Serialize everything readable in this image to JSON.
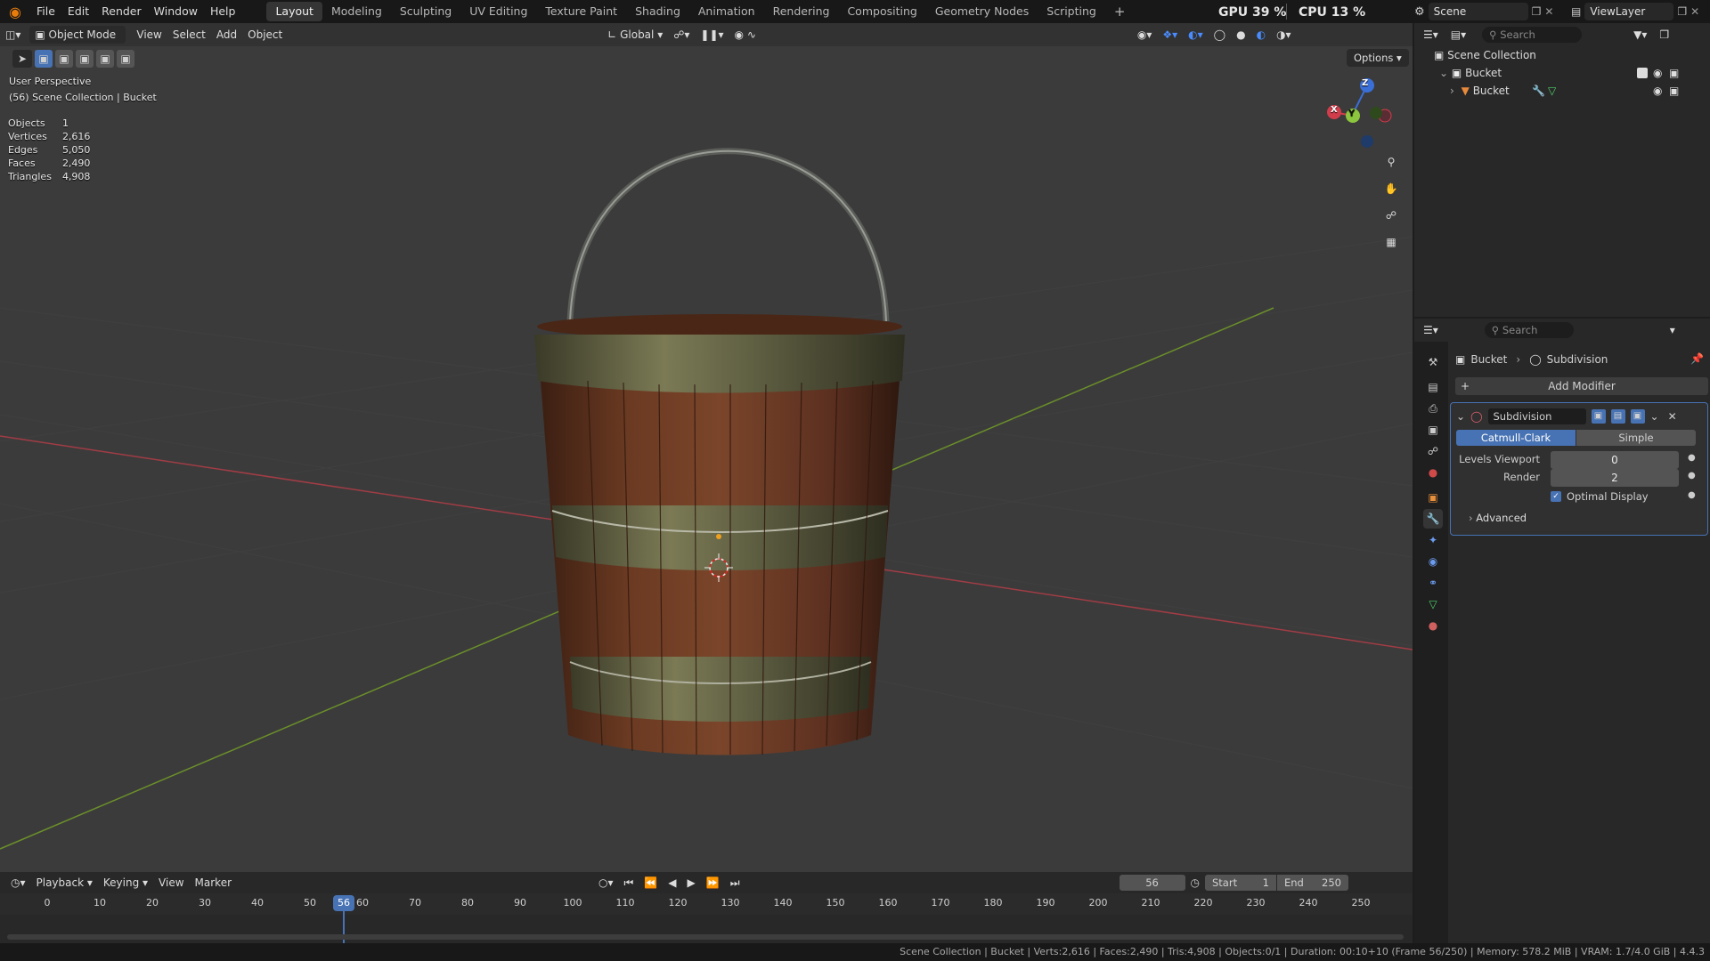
{
  "topbar": {
    "menus": [
      "File",
      "Edit",
      "Render",
      "Window",
      "Help"
    ],
    "workspaces": [
      "Layout",
      "Modeling",
      "Sculpting",
      "UV Editing",
      "Texture Paint",
      "Shading",
      "Animation",
      "Rendering",
      "Compositing",
      "Geometry Nodes",
      "Scripting"
    ],
    "active_workspace": "Layout",
    "add_label": "+",
    "gpu": "GPU 39 %",
    "cpu": "CPU 13 %",
    "scene": "Scene",
    "view_layer": "ViewLayer"
  },
  "viewport": {
    "mode": "Object Mode",
    "menus": [
      "View",
      "Select",
      "Add",
      "Object"
    ],
    "orientation": "Global",
    "options_label": "Options",
    "perspective": "User Perspective",
    "collection_info": "(56) Scene Collection | Bucket",
    "stats": [
      {
        "label": "Objects",
        "value": "1"
      },
      {
        "label": "Vertices",
        "value": "2,616"
      },
      {
        "label": "Edges",
        "value": "5,050"
      },
      {
        "label": "Faces",
        "value": "2,490"
      },
      {
        "label": "Triangles",
        "value": "4,908"
      }
    ],
    "gizmo": {
      "x": "X",
      "y": "Y",
      "z": "Z"
    }
  },
  "outliner": {
    "search_placeholder": "Search",
    "root": "Scene Collection",
    "collection": "Bucket",
    "object": "Bucket"
  },
  "properties": {
    "search_placeholder": "Search",
    "breadcrumb_object": "Bucket",
    "breadcrumb_modifier": "Subdivision",
    "add_modifier": "Add Modifier",
    "modifier_name": "Subdivision",
    "catmull": "Catmull-Clark",
    "simple": "Simple",
    "levels_viewport_label": "Levels Viewport",
    "levels_viewport_value": "0",
    "render_label": "Render",
    "render_value": "2",
    "optimal_display": "Optimal Display",
    "advanced": "Advanced"
  },
  "timeline": {
    "menus": [
      "Playback",
      "Keying",
      "View",
      "Marker"
    ],
    "current_frame": "56",
    "start_label": "Start",
    "start_value": "1",
    "end_label": "End",
    "end_value": "250",
    "ticks": [
      "0",
      "10",
      "20",
      "30",
      "40",
      "50",
      "60",
      "70",
      "80",
      "90",
      "100",
      "110",
      "120",
      "130",
      "140",
      "150",
      "160",
      "170",
      "180",
      "190",
      "200",
      "210",
      "220",
      "230",
      "240",
      "250"
    ],
    "playhead_label": "56"
  },
  "statusbar": {
    "text": "Scene Collection | Bucket | Verts:2,616 | Faces:2,490 | Tris:4,908 | Objects:0/1 | Duration: 00:10+10 (Frame 56/250) | Memory: 578.2 MiB | VRAM: 1.7/4.0 GiB | 4.4.3"
  },
  "colors": {
    "accent": "#4772b3",
    "x_axis": "#a13c45",
    "y_axis": "#6b8f2a",
    "active_tab": "#353535",
    "panel": "#282828"
  }
}
